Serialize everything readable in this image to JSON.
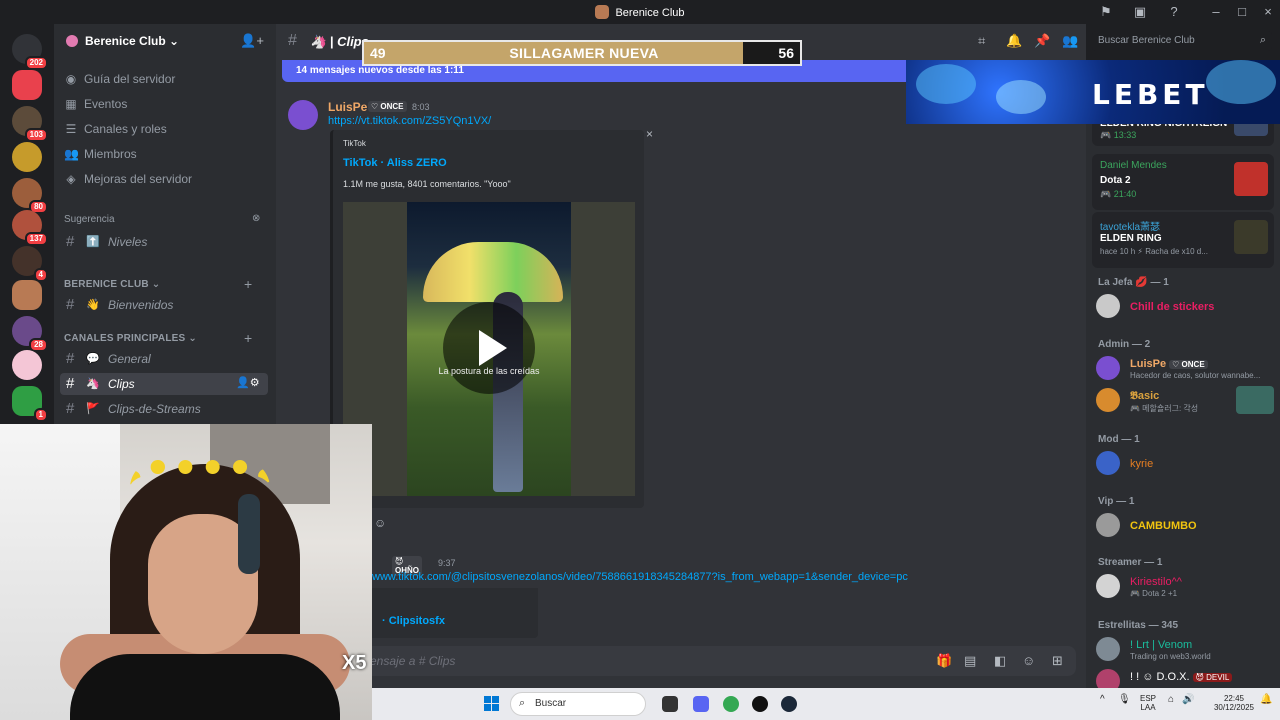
{
  "window": {
    "title": "Berenice Club"
  },
  "rail": {
    "badges": [
      "202",
      "103",
      "80",
      "137",
      "4",
      "28",
      "1"
    ]
  },
  "sidebar": {
    "guild_name": "Berenice Club",
    "nav": [
      {
        "label": "Guía del servidor",
        "icon": "compass-icon"
      },
      {
        "label": "Eventos",
        "icon": "calendar-icon"
      },
      {
        "label": "Canales y roles",
        "icon": "list-icon"
      },
      {
        "label": "Miembros",
        "icon": "members-icon"
      },
      {
        "label": "Mejoras del servidor",
        "icon": "boost-icon"
      }
    ],
    "suggestion_label": "Sugerencia",
    "suggestion_channel": "Niveles",
    "category1": "BERENICE CLUB",
    "channel_bienvenidos": "Bienvenidos",
    "category2": "CANALES PRINCIPALES",
    "channel_general": "General",
    "channel_clips": "Clips",
    "channel_streams": "Clips-de-Streams"
  },
  "header": {
    "channel": "Clips",
    "search_placeholder": "Buscar Berenice Club"
  },
  "new_messages": "14 mensajes nuevos desde las 1:11",
  "messages": {
    "m1": {
      "author": "LuisPe",
      "role": "ONCE",
      "time": "8:03",
      "link": "https://vt.tiktok.com/ZS5YQn1VX/",
      "embed_provider": "TikTok",
      "embed_title": "TikTok · Aliss ZERO",
      "embed_desc": "1.1M me gusta, 8401 comentarios. \"Yooo\"",
      "video_caption": "La postura de las creídas"
    },
    "m2": {
      "role": "OHÑO",
      "time": "9:37",
      "link": "www.tiktok.com/@clipsitosvenezolanos/video/7588661918345284877?is_from_webapp=1&sender_device=pc",
      "embed_title": "· Clipsitosfx"
    }
  },
  "composer": {
    "placeholder": "ensaje a # Clips"
  },
  "members": {
    "activities": [
      {
        "name": "",
        "game": "ELDEN RING NIGHTREIGN",
        "time": "13:33"
      },
      {
        "name": "Daniel Mendes",
        "game": "Dota 2",
        "time": "21:40"
      },
      {
        "name": "tavotekla萧瑟",
        "game": "ELDEN RING",
        "time": "hace 10 h  ⚡ Racha de x10 d..."
      }
    ],
    "groups": [
      {
        "title": "La Jefa 💋 — 1",
        "members": [
          {
            "name": "Chill de stickers",
            "status": "",
            "color": "#e91e63"
          }
        ]
      },
      {
        "title": "Admin — 2",
        "members": [
          {
            "name": "LuisPe",
            "status": "Hacedor de caos, solutor wannabe...",
            "color": "#f0a867"
          },
          {
            "name": "𝕭asic",
            "status": "🎮 메할숄러그: 각성 ",
            "color": "#d9a13e"
          }
        ]
      },
      {
        "title": "Mod — 1",
        "members": [
          {
            "name": "kyrie",
            "status": "",
            "color": "#e67e22"
          }
        ]
      },
      {
        "title": "Vip — 1",
        "members": [
          {
            "name": "CAMBUMBO",
            "status": "",
            "color": "#f1c40f"
          }
        ]
      },
      {
        "title": "Streamer — 1",
        "members": [
          {
            "name": "Kiriestilo^^",
            "status": "🎮 Dota 2 +1",
            "color": "#e91e63"
          }
        ]
      },
      {
        "title": "Estrellitas — 345",
        "members": [
          {
            "name": "! Lrt | Venom",
            "status": "Trading on web3.world",
            "color": "#1abc9c"
          },
          {
            "name": "! ! ☺ D.O.X.",
            "status": "",
            "color": "#ffffff"
          }
        ]
      }
    ]
  },
  "overlay": {
    "left_score": "49",
    "label": "SILLAGAMER NUEVA",
    "right_score": "56",
    "fill_fraction": 0.87,
    "promo_word": "LEBET",
    "multiplier": "X5"
  },
  "taskbar": {
    "search": "Buscar",
    "lang": "ESP",
    "region": "LAA",
    "time": "22:45",
    "date": "30/12/2025"
  }
}
